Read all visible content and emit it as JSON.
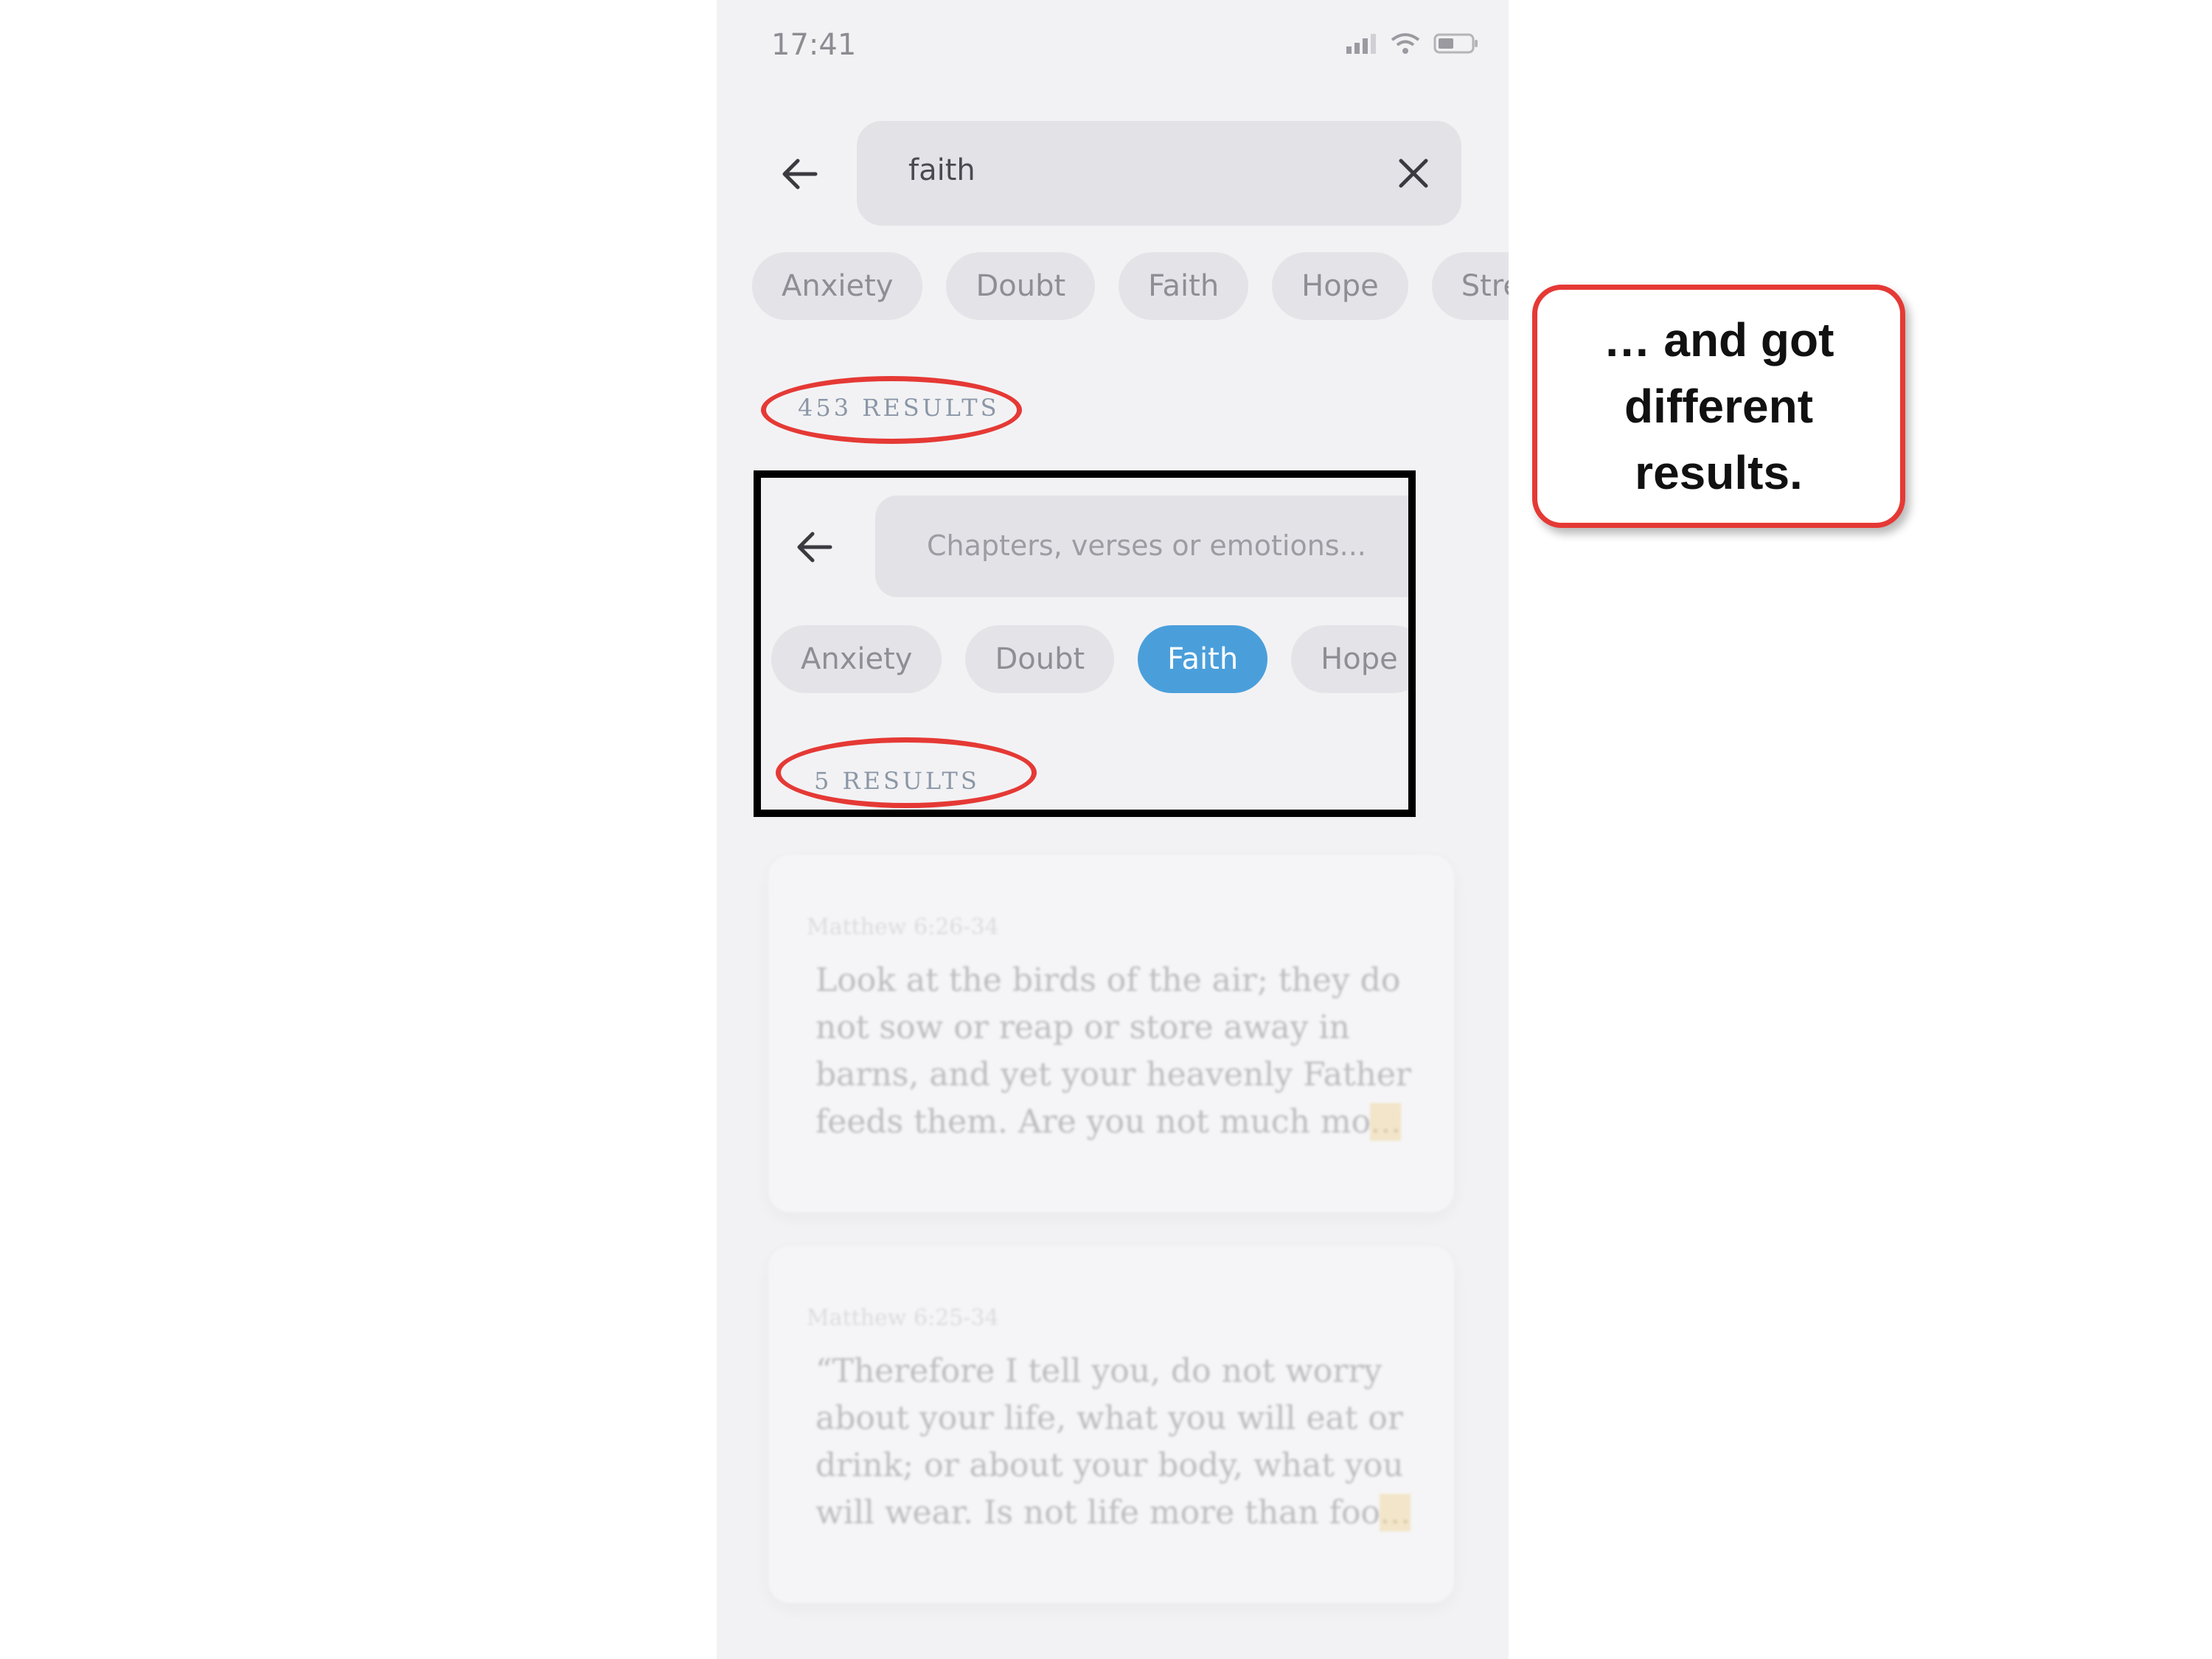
{
  "status_bar": {
    "time": "17:41"
  },
  "search": {
    "query": "faith"
  },
  "chips": [
    "Anxiety",
    "Doubt",
    "Faith",
    "Hope",
    "Stres"
  ],
  "results_count": "453 RESULTS",
  "inset": {
    "placeholder": "Chapters, verses or emotions...",
    "chips": [
      "Anxiety",
      "Doubt",
      "Faith",
      "Hope"
    ],
    "active_chip": "Faith",
    "results_count": "5 RESULTS"
  },
  "cards": [
    {
      "reference": "Matthew 6:26-34",
      "text": "Look at the birds of the air; they do not sow or reap or store away in barns, and yet your heavenly Father feeds them. Are you not much mo",
      "ellipsis": "..."
    },
    {
      "reference": "Matthew 6:25-34",
      "text": "“Therefore I tell you, do not worry about your life, what you will eat or drink; or about your body, what you will wear. Is not life more than foo",
      "ellipsis": "..."
    }
  ],
  "callout": {
    "text": "… and got different results."
  },
  "colors": {
    "accent": "#4a9fdb",
    "annotation": "#e53935"
  }
}
